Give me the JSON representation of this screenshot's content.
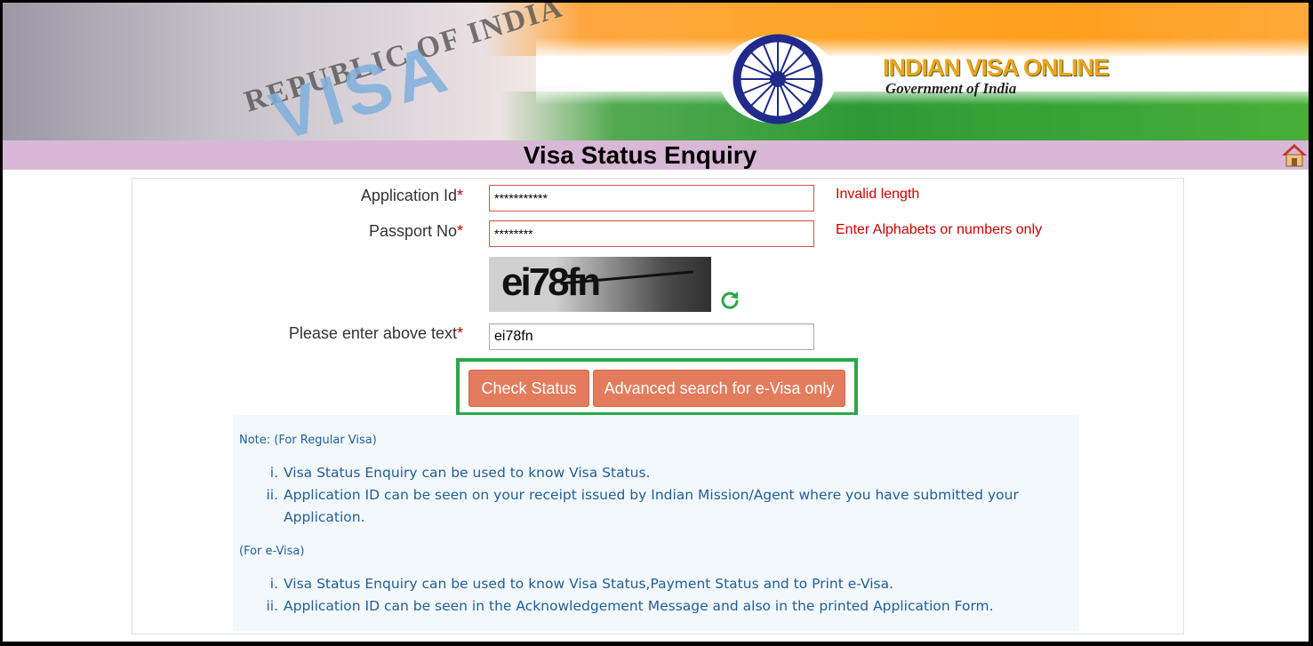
{
  "header": {
    "site_name": "INDIAN VISA ONLINE",
    "site_sub": "Government of India",
    "banner_visa_word": "VISA",
    "banner_republic_text": "REPUBLIC OF INDIA",
    "page_title": "Visa Status Enquiry",
    "home_icon": "home-icon"
  },
  "form": {
    "application_id": {
      "label": "Application Id",
      "value": "***********",
      "error": "Invalid length"
    },
    "passport_no": {
      "label": "Passport No",
      "value": "********",
      "error": "Enter Alphabets or numbers only"
    },
    "captcha": {
      "text": "ei78fn",
      "refresh_icon": "refresh-icon"
    },
    "captcha_input": {
      "label": "Please enter above text",
      "value": "ei78fn"
    },
    "required_mark": "*",
    "buttons": {
      "check_status": "Check Status",
      "advanced_search": "Advanced search for e-Visa only"
    }
  },
  "notes": {
    "regular_heading": "Note: (For Regular Visa)",
    "regular_items": [
      {
        "num": "i.",
        "text": "Visa Status Enquiry can be used to know Visa Status."
      },
      {
        "num": "ii.",
        "text": "Application ID can be seen on your receipt issued by Indian Mission/Agent where you have submitted your Application."
      }
    ],
    "evisa_heading": "(For e-Visa)",
    "evisa_items": [
      {
        "num": "i.",
        "text": "Visa Status Enquiry can be used to know Visa Status,Payment Status and to Print e-Visa."
      },
      {
        "num": "ii.",
        "text": "Application ID can be seen in the Acknowledgement Message and also in the printed Application Form."
      }
    ]
  },
  "colors": {
    "title_bar": "#d8b8d6",
    "button": "#e37c5d",
    "error": "#cc0000",
    "note_text": "#1f5f9a",
    "highlight_box": "#2aa84a"
  }
}
